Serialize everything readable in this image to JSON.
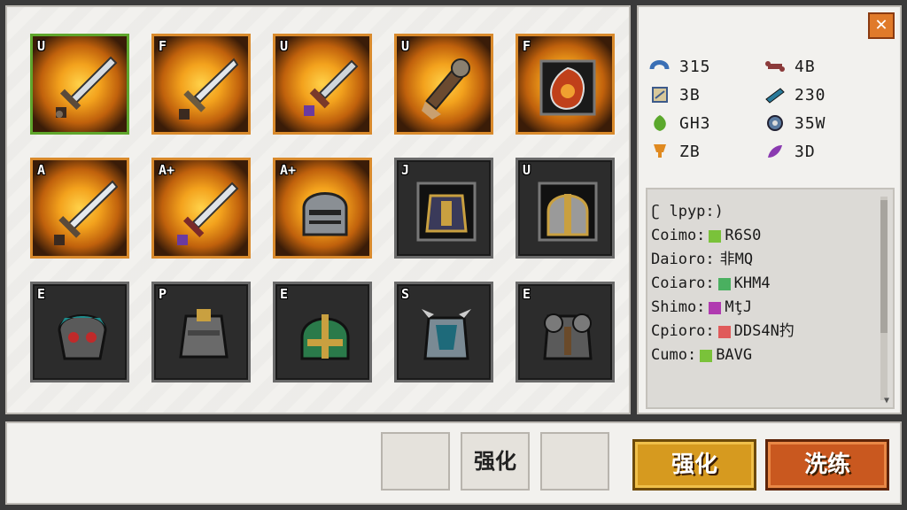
{
  "inventory": {
    "slots": [
      {
        "tag": "U",
        "icon": "broadsword-icon",
        "style": "gold",
        "selected": true
      },
      {
        "tag": "F",
        "icon": "sword-icon",
        "style": "gold"
      },
      {
        "tag": "U",
        "icon": "short-sword-icon",
        "style": "gold"
      },
      {
        "tag": "U",
        "icon": "bone-club-icon",
        "style": "gold"
      },
      {
        "tag": "F",
        "icon": "fire-gem-icon",
        "style": "gold"
      },
      {
        "tag": "A",
        "icon": "longsword-icon",
        "style": "gold"
      },
      {
        "tag": "A+",
        "icon": "crystal-sword-icon",
        "style": "gold"
      },
      {
        "tag": "A+",
        "icon": "knight-helmet-icon",
        "style": "gold"
      },
      {
        "tag": "J",
        "icon": "gold-armor-icon",
        "style": "dark"
      },
      {
        "tag": "U",
        "icon": "great-helm-icon",
        "style": "dark"
      },
      {
        "tag": "E",
        "icon": "skull-mask-icon",
        "style": "dark"
      },
      {
        "tag": "P",
        "icon": "plate-armor-icon",
        "style": "dark"
      },
      {
        "tag": "E",
        "icon": "green-helmet-icon",
        "style": "dark"
      },
      {
        "tag": "S",
        "icon": "spiked-armor-icon",
        "style": "dark"
      },
      {
        "tag": "E",
        "icon": "heavy-armor-icon",
        "style": "dark"
      }
    ]
  },
  "stats": [
    {
      "icon": "horseshoe-icon",
      "color": "#3a6fb5",
      "value": "315"
    },
    {
      "icon": "bone-icon",
      "color": "#8b3a3a",
      "value": "4B"
    },
    {
      "icon": "scroll-icon",
      "color": "#3d5a8a",
      "value": "3B"
    },
    {
      "icon": "blade-icon",
      "color": "#2a7a9a",
      "value": "230"
    },
    {
      "icon": "leaf-icon",
      "color": "#5ba82c",
      "value": "GH3"
    },
    {
      "icon": "gear-icon",
      "color": "#5a7aa0",
      "value": "35W"
    },
    {
      "icon": "trophy-icon",
      "color": "#e08a20",
      "value": "ZB"
    },
    {
      "icon": "feather-icon",
      "color": "#8a3ab0",
      "value": "3D"
    }
  ],
  "log": {
    "header": "ʗ lpyp:)",
    "lines": [
      {
        "label": "Coimo:",
        "chip": "#7ac23a",
        "value": "R6S0"
      },
      {
        "label": "Daioro:",
        "chip": "",
        "value": "非MQ"
      },
      {
        "label": "Coiaro:",
        "chip": "#4ab060",
        "value": "KHM4"
      },
      {
        "label": "Shimo:",
        "chip": "#b03ab0",
        "value": "MţJ"
      },
      {
        "label": "Cpioro:",
        "chip": "#e05a5a",
        "value": "DDS4N扚"
      },
      {
        "label": "Cumo:",
        "chip": "#7ac23a",
        "value": "BAVG"
      }
    ]
  },
  "close": {
    "label": "✕"
  },
  "bottom": {
    "slot_label": "强化",
    "enhance_label": "强化",
    "reroll_label": "洗练"
  }
}
